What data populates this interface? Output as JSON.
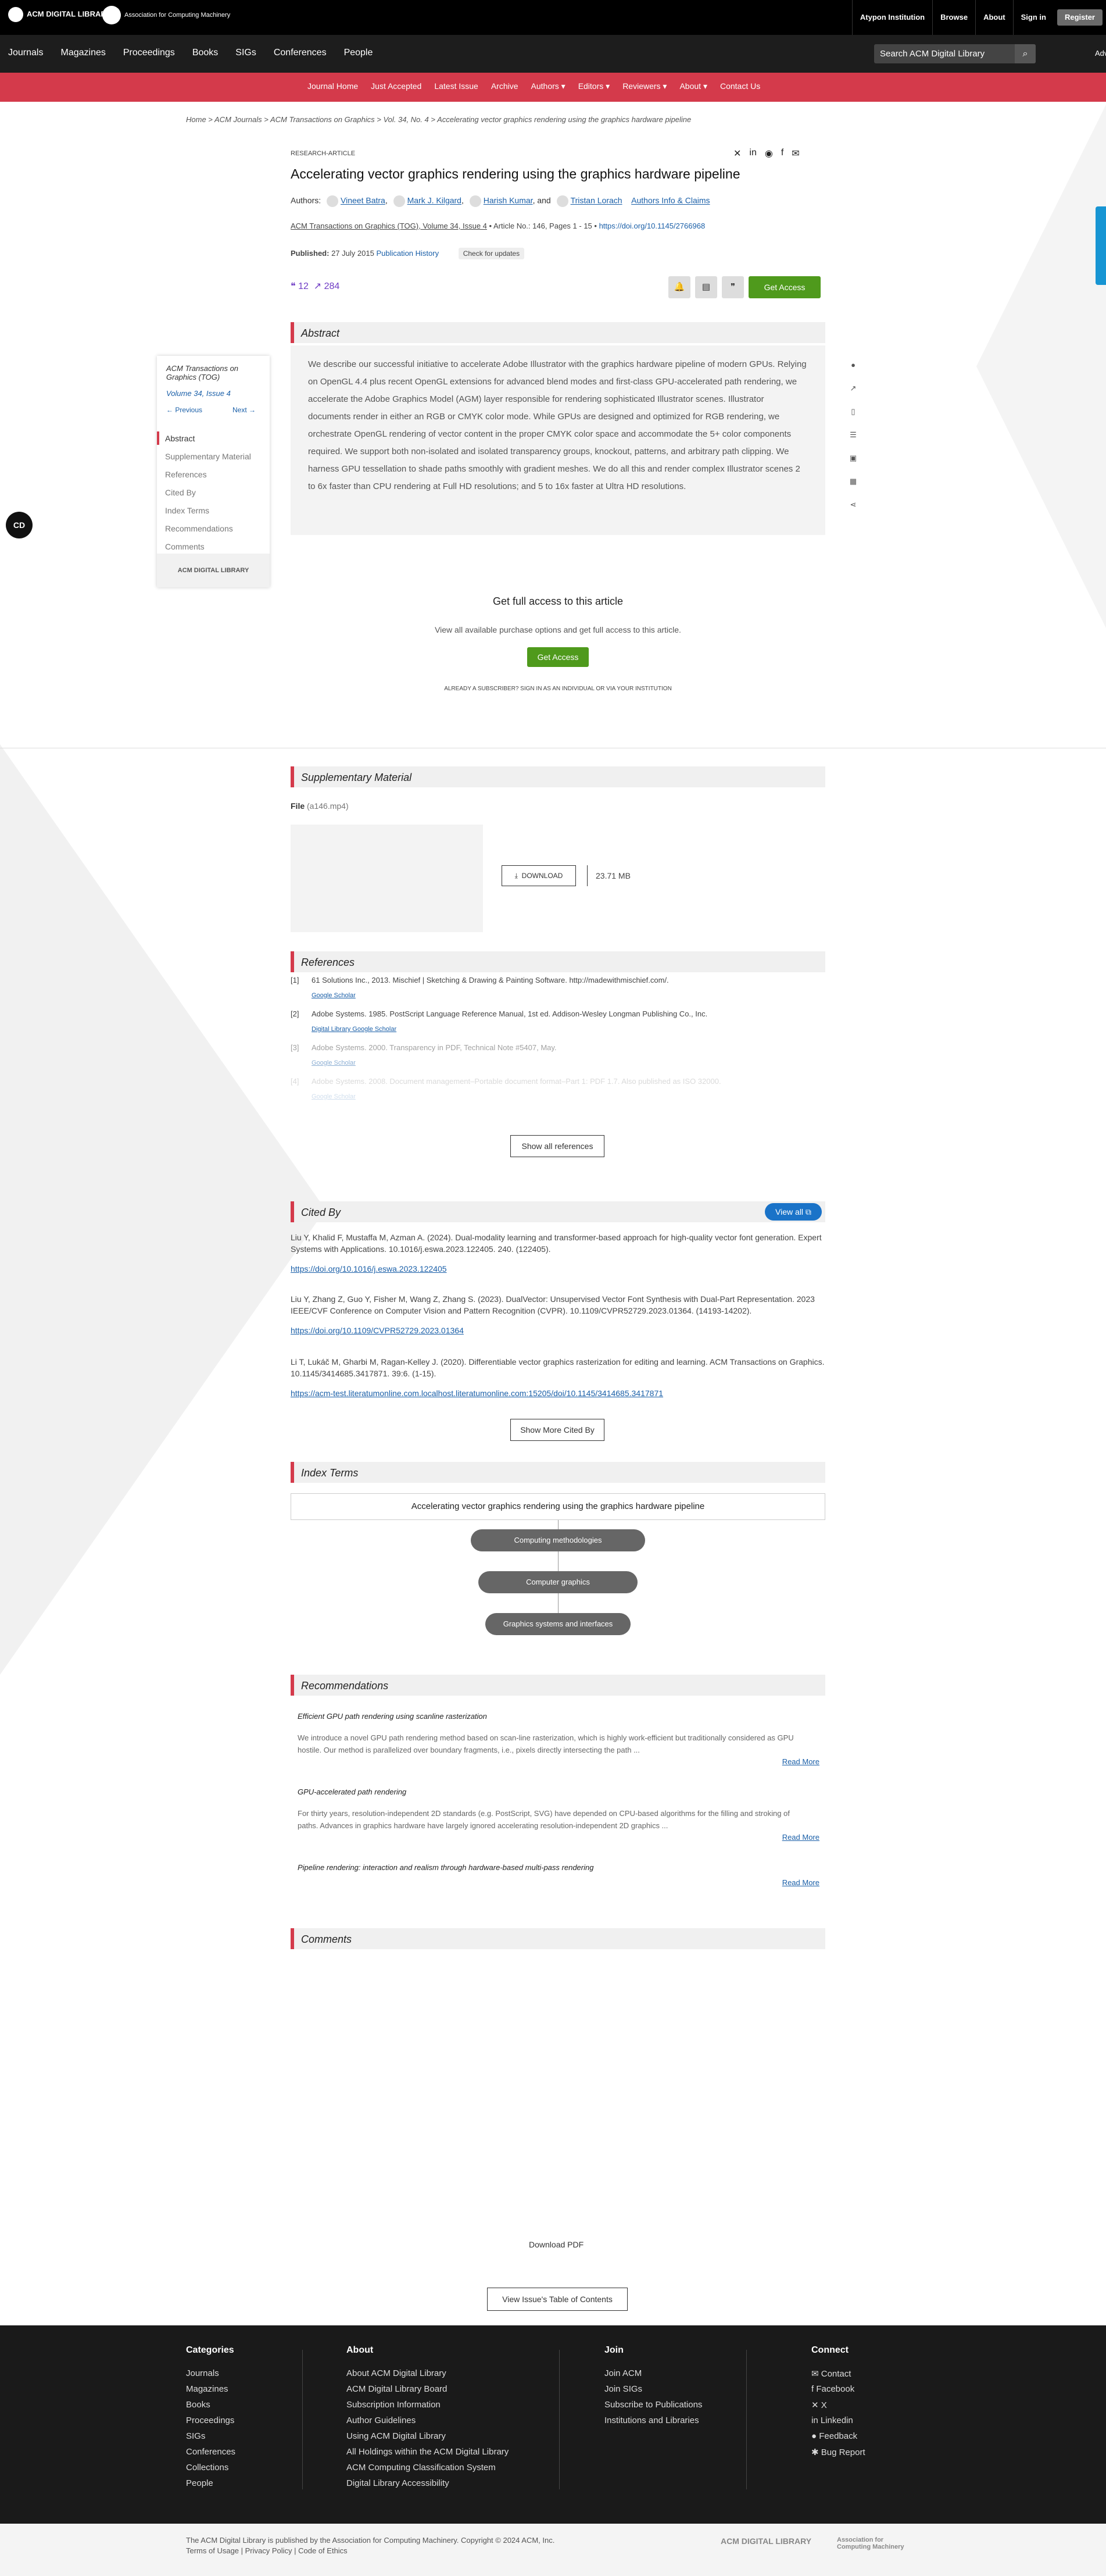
{
  "topbar": {
    "logo_text": "ACM DIGITAL LIBRARY",
    "assoc_text": "Association for Computing Machinery",
    "links": [
      "Atypon Institution",
      "Browse",
      "About",
      "Sign in"
    ],
    "register": "Register"
  },
  "nav": {
    "items": [
      "Journals",
      "Magazines",
      "Proceedings",
      "Books",
      "SIGs",
      "Conferences",
      "People"
    ],
    "search_placeholder": "Search ACM Digital Library",
    "advanced": "Advanced Search"
  },
  "journal_nav": {
    "items": [
      "Journal Home",
      "Just Accepted",
      "Latest Issue",
      "Archive",
      "Authors ▾",
      "Editors ▾",
      "Reviewers ▾",
      "About ▾",
      "Contact Us"
    ]
  },
  "breadcrumb": "Home  >  ACM Journals  >  ACM Transactions on Graphics  >  Vol. 34, No. 4  >  Accelerating vector graphics rendering using the graphics hardware pipeline",
  "article": {
    "type": "RESEARCH-ARTICLE",
    "title": "Accelerating vector graphics rendering using the graphics hardware pipeline",
    "authors_label": "Authors:",
    "authors": [
      "Vineet Batra",
      "Mark J. Kilgard",
      "Harish Kumar",
      "Tristan Lorach"
    ],
    "and": ", and",
    "authors_info": "Authors Info & Claims",
    "journal_line": "ACM Transactions on Graphics (TOG), Volume 34, Issue 4",
    "article_meta": " • Article No.: 146, Pages 1 - 15 • ",
    "doi": "https://doi.org/10.1145/2766968",
    "published_label": "Published:",
    "published_date": "27 July 2015",
    "pub_history": "Publication History",
    "check_updates": "Check for updates",
    "citations": "12",
    "downloads": "284",
    "get_access": "Get Access"
  },
  "abstract": {
    "heading": "Abstract",
    "text": "We describe our successful initiative to accelerate Adobe Illustrator with the graphics hardware pipeline of modern GPUs. Relying on OpenGL 4.4 plus recent OpenGL extensions for advanced blend modes and first-class GPU-accelerated path rendering, we accelerate the Adobe Graphics Model (AGM) layer responsible for rendering sophisticated Illustrator scenes. Illustrator documents render in either an RGB or CMYK color mode. While GPUs are designed and optimized for RGB rendering, we orchestrate OpenGL rendering of vector content in the proper CMYK color space and accommodate the 5+ color components required. We support both non-isolated and isolated transparency groups, knockout, patterns, and arbitrary path clipping. We harness GPU tessellation to shade paths smoothly with gradient meshes. We do all this and render complex Illustrator scenes 2 to 6x faster than CPU rendering at Full HD resolutions; and 5 to 16x faster at Ultra HD resolutions."
  },
  "toc": {
    "journal": "ACM Transactions on Graphics (TOG)",
    "volume": "Volume 34, Issue 4",
    "previous": "← Previous",
    "next": "Next →",
    "items": [
      "Abstract",
      "Supplementary Material",
      "References",
      "Cited By",
      "Index Terms",
      "Recommendations",
      "Comments"
    ],
    "logo": "ACM DIGITAL LIBRARY"
  },
  "access": {
    "heading": "Get full access to this article",
    "text": "View all available purchase options and get full access to this article.",
    "button": "Get Access",
    "signin": "ALREADY A SUBSCRIBER? SIGN IN AS AN INDIVIDUAL OR VIA YOUR INSTITUTION"
  },
  "supplementary": {
    "heading": "Supplementary Material",
    "file_label": "File",
    "file_name": "(a146.mp4)",
    "download": "DOWNLOAD",
    "size": "23.71 MB"
  },
  "references": {
    "heading": "References",
    "items": [
      {
        "n": "[1]",
        "text": "61 Solutions Inc., 2013. Mischief | Sketching & Drawing & Painting Software. http://madewithmischief.com/.",
        "links": "Google Scholar"
      },
      {
        "n": "[2]",
        "text": "Adobe Systems. 1985. PostScript Language Reference Manual, 1st ed. Addison-Wesley Longman Publishing Co., Inc.",
        "links": "Digital Library     Google Scholar"
      },
      {
        "n": "[3]",
        "text": "Adobe Systems. 2000. Transparency in PDF, Technical Note #5407, May.",
        "links": "Google Scholar"
      },
      {
        "n": "[4]",
        "text": "Adobe Systems. 2008. Document management–Portable document format–Part 1: PDF 1.7. Also published as ISO 32000.",
        "links": "Google Scholar"
      }
    ],
    "show_all": "Show all references"
  },
  "cited_by": {
    "heading": "Cited By",
    "view_all": "View all",
    "items": [
      {
        "text": "Liu Y, Khalid F, Mustaffa M, Azman A. (2024). Dual-modality learning and transformer-based approach for high-quality vector font generation. Expert Systems with Applications. 10.1016/j.eswa.2023.122405. 240. (122405).",
        "link": "https://doi.org/10.1016/j.eswa.2023.122405"
      },
      {
        "text": "Liu Y, Zhang Z, Guo Y, Fisher M, Wang Z, Zhang S. (2023). DualVector: Unsupervised Vector Font Synthesis with Dual-Part Representation. 2023 IEEE/CVF Conference on Computer Vision and Pattern Recognition (CVPR). 10.1109/CVPR52729.2023.01364. (14193-14202).",
        "link": "https://doi.org/10.1109/CVPR52729.2023.01364"
      },
      {
        "text": "Li T, Lukáč M, Gharbi M, Ragan-Kelley J. (2020). Differentiable vector graphics rasterization for editing and learning. ACM Transactions on Graphics. 10.1145/3414685.3417871. 39:6. (1-15).",
        "link": "https://acm-test.literatumonline.com.localhost.literatumonline.com:15205/doi/10.1145/3414685.3417871"
      }
    ],
    "show_more": "Show More Cited By"
  },
  "index_terms": {
    "heading": "Index Terms",
    "root": "Accelerating vector graphics rendering using the graphics hardware pipeline",
    "nodes": [
      "Computing methodologies",
      "Computer graphics",
      "Graphics systems and interfaces"
    ]
  },
  "recommendations": {
    "heading": "Recommendations",
    "read_more": "Read More",
    "items": [
      {
        "title": "Efficient GPU path rendering using scanline rasterization",
        "desc": "We introduce a novel GPU path rendering method based on scan-line rasterization, which is highly work-efficient but traditionally considered as GPU hostile. Our method is parallelized over boundary fragments, i.e., pixels directly intersecting the path ..."
      },
      {
        "title": "GPU-accelerated path rendering",
        "desc": "For thirty years, resolution-independent 2D standards (e.g. PostScript, SVG) have depended on CPU-based algorithms for the filling and stroking of paths. Advances in graphics hardware have largely ignored accelerating resolution-independent 2D graphics ..."
      },
      {
        "title": "Pipeline rendering: interaction and realism through hardware-based multi-pass rendering",
        "desc": ""
      }
    ]
  },
  "comments": {
    "heading": "Comments"
  },
  "bottom_links": {
    "download_pdf": "Download PDF",
    "view_toc": "View Issue's Table of Contents"
  },
  "footer": {
    "categories": {
      "heading": "Categories",
      "items": [
        "Journals",
        "Magazines",
        "Books",
        "Proceedings",
        "SIGs",
        "Conferences",
        "Collections",
        "People"
      ]
    },
    "about": {
      "heading": "About",
      "items": [
        "About ACM Digital Library",
        "ACM Digital Library Board",
        "Subscription Information",
        "Author Guidelines",
        "Using ACM Digital Library",
        "All Holdings within the ACM Digital Library",
        "ACM Computing Classification System",
        "Digital Library Accessibility"
      ]
    },
    "join": {
      "heading": "Join",
      "items": [
        "Join ACM",
        "Join SIGs",
        "Subscribe to Publications",
        "Institutions and Libraries"
      ]
    },
    "connect": {
      "heading": "Connect",
      "items": [
        "✉  Contact",
        "f  Facebook",
        "✕  X",
        "in  Linkedin",
        "●  Feedback",
        "✱  Bug Report"
      ]
    },
    "copyright": "The ACM Digital Library is published by the Association for Computing Machinery. Copyright © 2024 ACM, Inc.",
    "legal": "Terms of Usage  |  Privacy Policy  |  Code of Ethics",
    "logo1": "ACM DIGITAL LIBRARY",
    "logo2": "Association for Computing Machinery"
  }
}
